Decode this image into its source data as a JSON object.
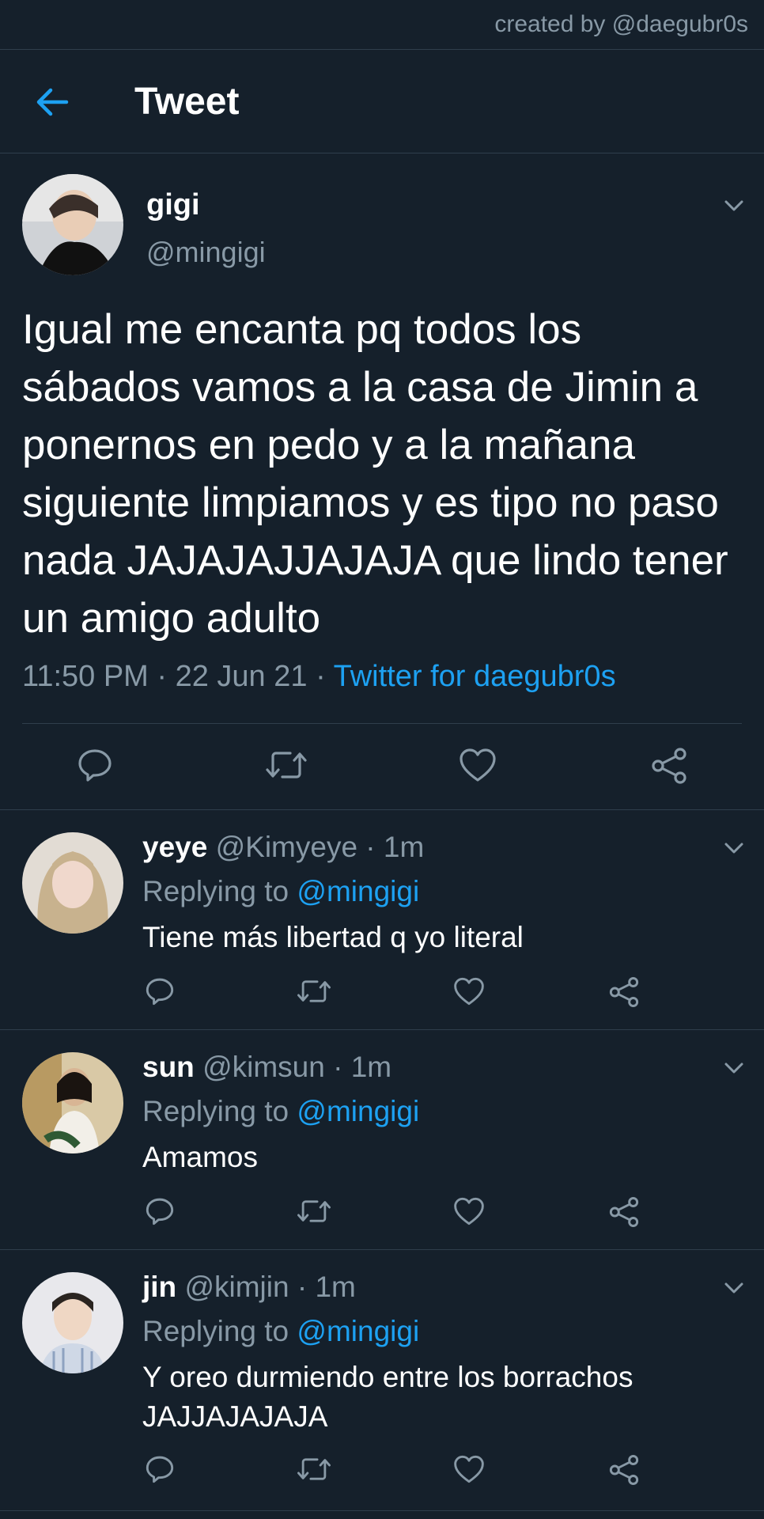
{
  "credit": "created by @daegubr0s",
  "header": {
    "title": "Tweet"
  },
  "tweet": {
    "name": "gigi",
    "handle": "@mingigi",
    "text": "Igual me encanta pq todos los sábados vamos a la casa de Jimin a ponernos en pedo y a la mañana siguiente limpiamos y es tipo no paso nada JAJAJAJJAJAJA que lindo tener un amigo adulto",
    "time": "11:50 PM · 22 Jun 21 · ",
    "source": "Twitter for daegubr0s"
  },
  "replies": [
    {
      "name": "yeye",
      "handle": "@Kimyeye · 1m",
      "replying_prefix": "Replying to ",
      "replying_to": "@mingigi",
      "text": "Tiene más libertad q yo literal"
    },
    {
      "name": "sun",
      "handle": "@kimsun · 1m",
      "replying_prefix": "Replying to ",
      "replying_to": "@mingigi",
      "text": "Amamos"
    },
    {
      "name": "jin",
      "handle": "@kimjin · 1m",
      "replying_prefix": "Replying to ",
      "replying_to": "@mingigi",
      "text": "Y oreo durmiendo entre los borrachos JAJJAJAJAJA"
    }
  ],
  "colors": {
    "background": "#15202b",
    "accent": "#1da1f2",
    "secondary_text": "#8899a6",
    "divider": "#2f3e4c"
  },
  "icons": [
    "back-arrow-icon",
    "chevron-down-icon",
    "reply-icon",
    "retweet-icon",
    "like-icon",
    "share-icon"
  ]
}
